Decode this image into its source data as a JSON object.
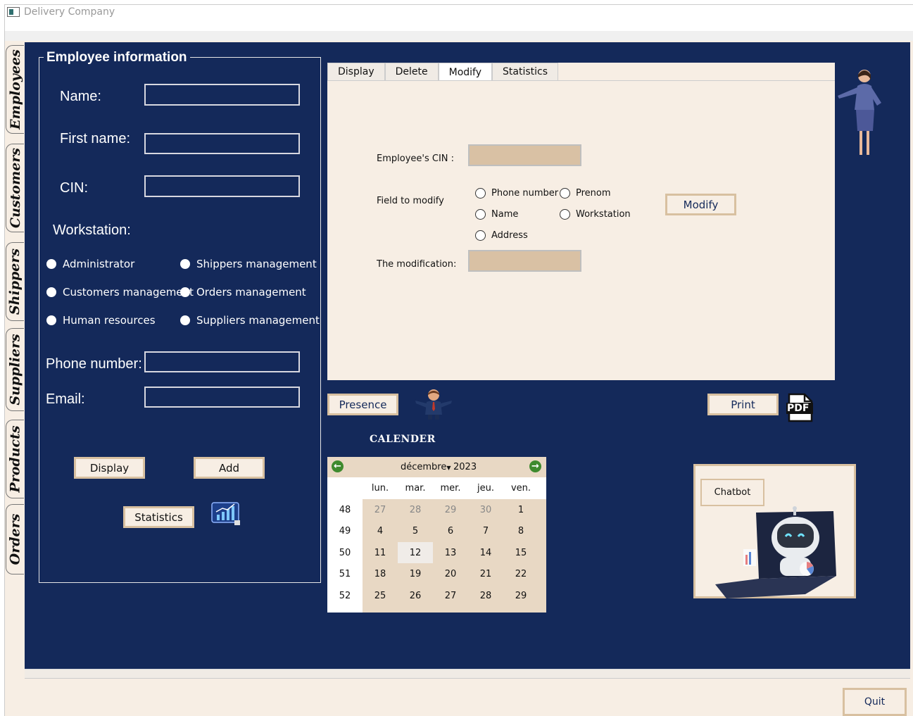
{
  "window": {
    "title": "Delivery Company"
  },
  "side_tabs": [
    {
      "label": "Employees",
      "active": true
    },
    {
      "label": "Customers",
      "active": false
    },
    {
      "label": "Shippers",
      "active": false
    },
    {
      "label": "Suppliers",
      "active": false
    },
    {
      "label": "Products",
      "active": false
    },
    {
      "label": "Orders",
      "active": false
    }
  ],
  "employee_form": {
    "group_title": "Employee information",
    "name_label": "Name:",
    "name_value": "",
    "first_name_label": "First name:",
    "first_name_value": "",
    "cin_label": "CIN:",
    "cin_value": "",
    "workstation_label": "Workstation:",
    "workstations": [
      "Administrator",
      "Shippers management",
      "Customers management",
      "Orders management",
      "Human resources",
      "Suppliers management"
    ],
    "phone_label": "Phone number:",
    "phone_value": "",
    "email_label": "Email:",
    "email_value": "",
    "display_button": "Display",
    "add_button": "Add",
    "statistics_button": "Statistics"
  },
  "tabs": {
    "items": [
      "Display",
      "Delete",
      "Modify",
      "Statistics"
    ],
    "active": "Modify"
  },
  "modify_panel": {
    "cin_label": "Employee's CIN :",
    "cin_value": "",
    "field_label": "Field to modify",
    "fields": [
      "Phone number",
      "Prenom",
      "Name",
      "Workstation",
      "Address"
    ],
    "modification_label": "The modification:",
    "modification_value": "",
    "modify_button": "Modify"
  },
  "actions": {
    "presence_button": "Presence",
    "print_button": "Print",
    "pdf_icon_text": "PDF"
  },
  "calendar": {
    "title": "CALENDER",
    "month": "décembre",
    "year": "2023",
    "weekdays": [
      "lun.",
      "mar.",
      "mer.",
      "jeu.",
      "ven."
    ],
    "weeks": [
      {
        "num": "48",
        "days": [
          "27",
          "28",
          "29",
          "30",
          "1"
        ]
      },
      {
        "num": "49",
        "days": [
          "4",
          "5",
          "6",
          "7",
          "8"
        ]
      },
      {
        "num": "50",
        "days": [
          "11",
          "12",
          "13",
          "14",
          "15"
        ]
      },
      {
        "num": "51",
        "days": [
          "18",
          "19",
          "20",
          "21",
          "22"
        ]
      },
      {
        "num": "52",
        "days": [
          "25",
          "26",
          "27",
          "28",
          "29"
        ]
      }
    ],
    "selected_day": "12"
  },
  "chatbot": {
    "button": "Chatbot"
  },
  "footer": {
    "quit_button": "Quit"
  }
}
